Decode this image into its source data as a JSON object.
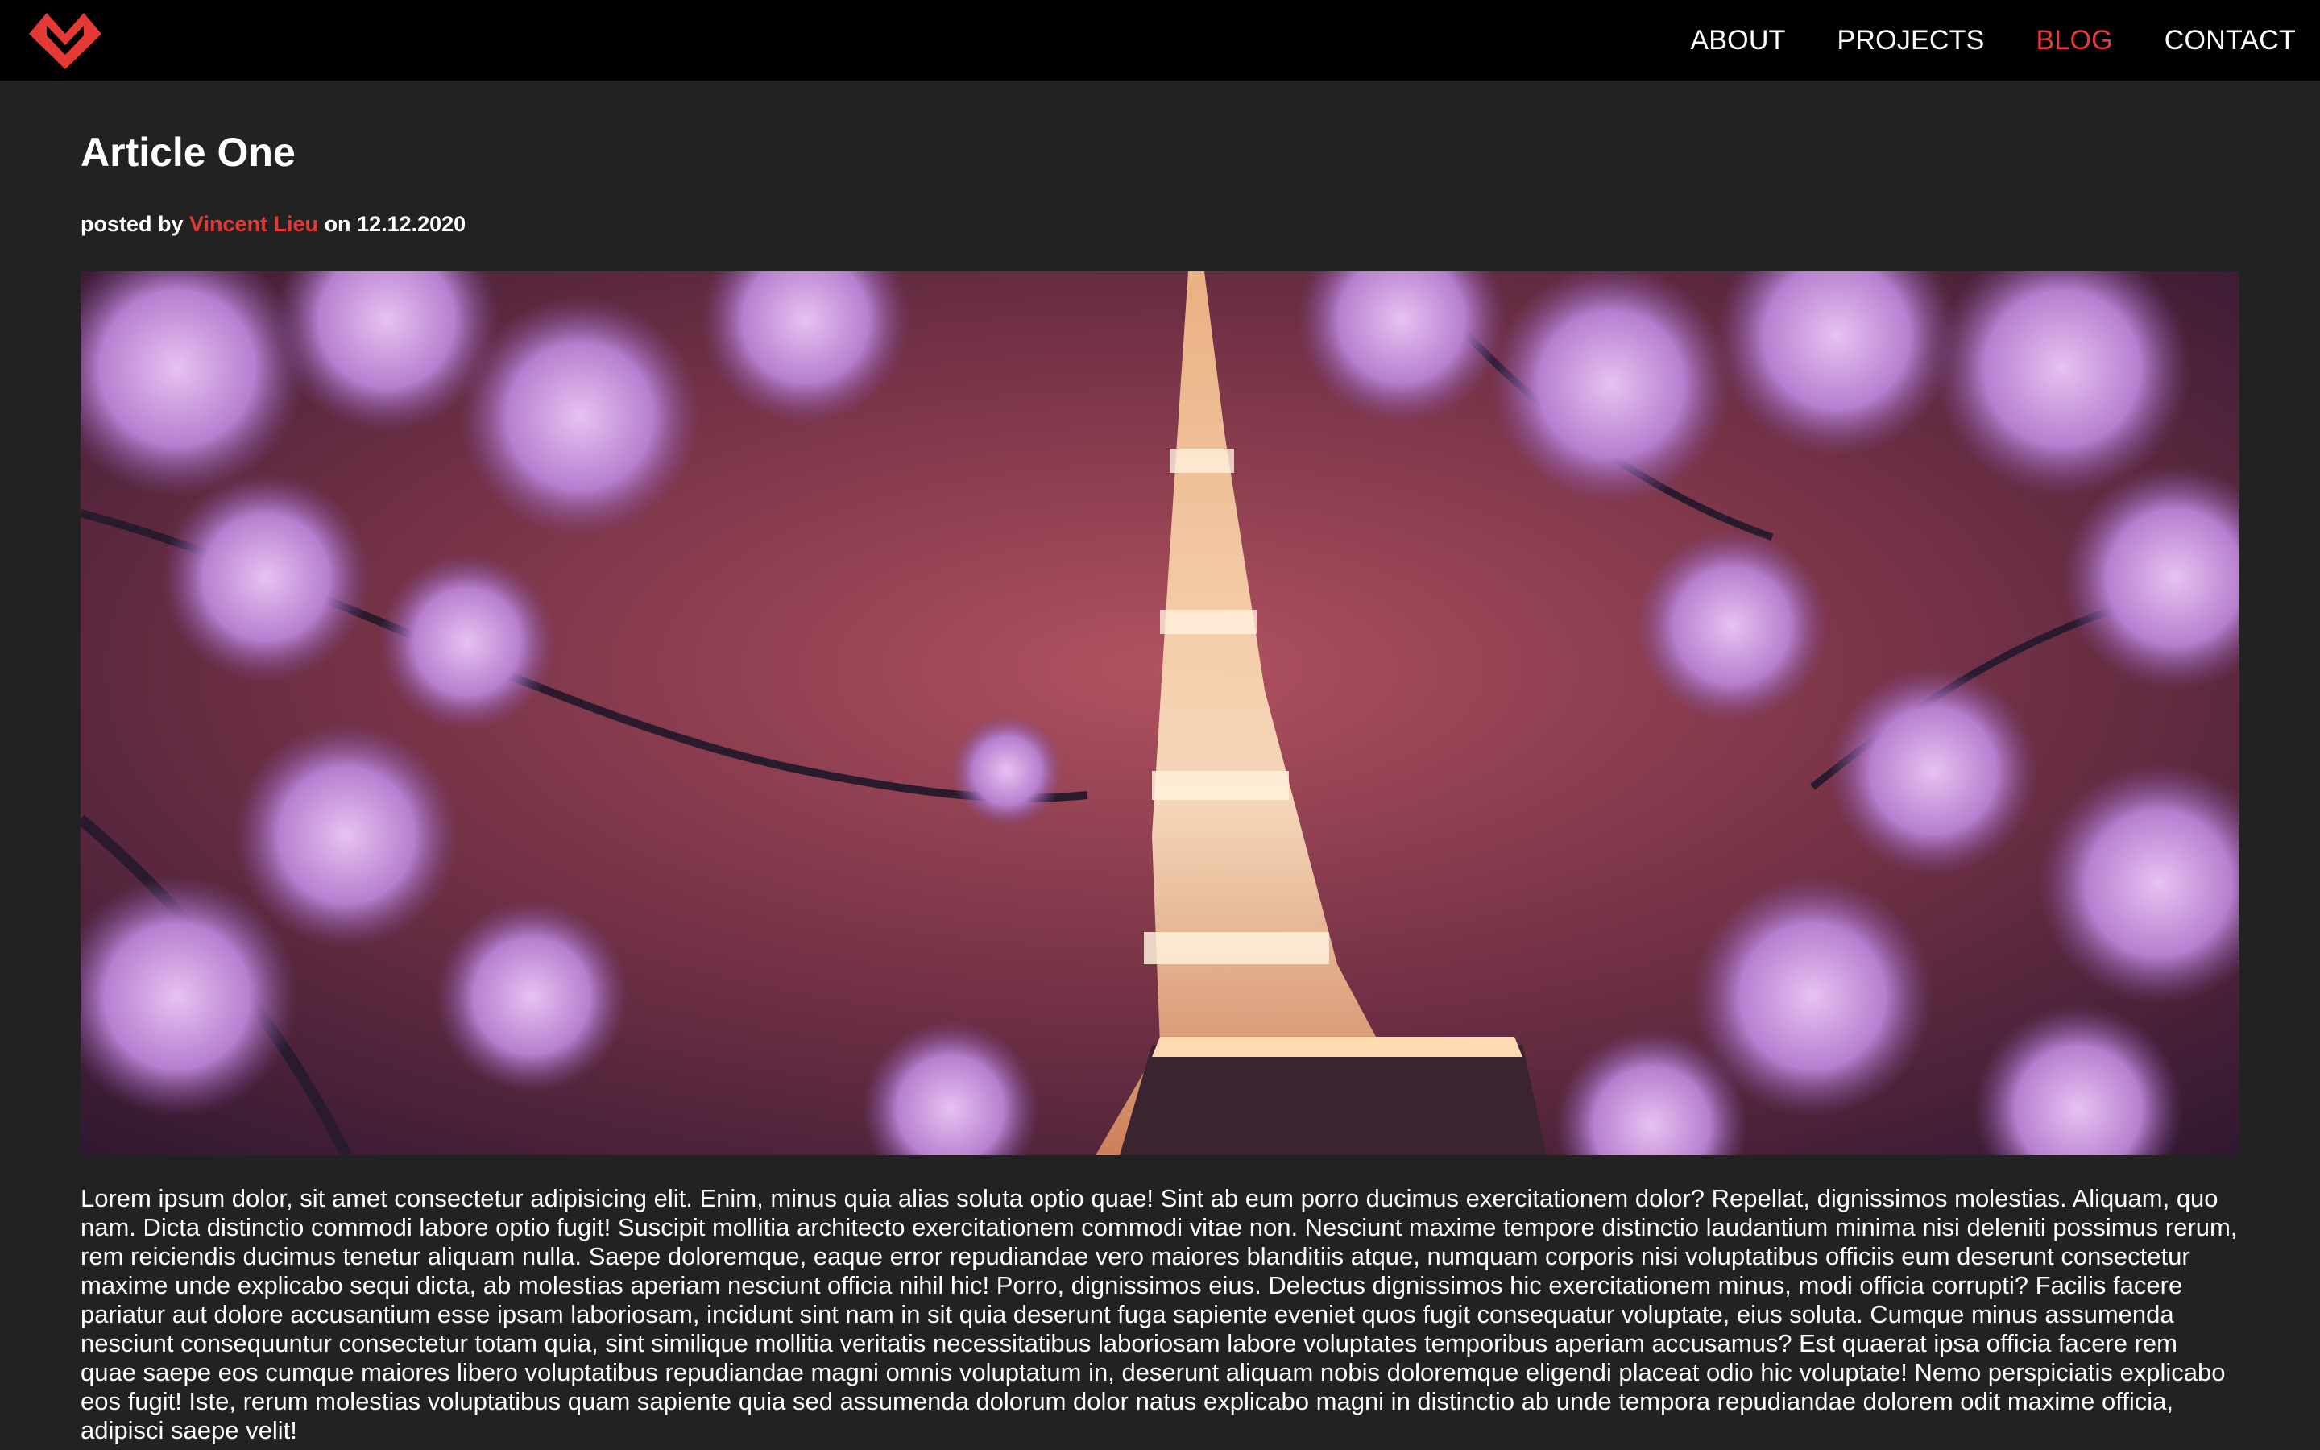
{
  "nav": {
    "links": [
      {
        "label": "ABOUT",
        "active": false
      },
      {
        "label": "PROJECTS",
        "active": false
      },
      {
        "label": "BLOG",
        "active": true
      },
      {
        "label": "CONTACT",
        "active": false
      }
    ],
    "logo_icon": "chevron-heart-logo",
    "accent_color": "#e53935"
  },
  "article": {
    "title": "Article One",
    "byline_prefix": "posted by ",
    "author": "Vincent Lieu",
    "byline_mid": " on ",
    "date": "12.12.2020",
    "hero_image": "tower-cherry-blossoms-photo",
    "body": "Lorem ipsum dolor, sit amet consectetur adipisicing elit. Enim, minus quia alias soluta optio quae! Sint ab eum porro ducimus exercitationem dolor? Repellat, dignissimos molestias. Aliquam, quo nam. Dicta distinctio commodi labore optio fugit! Suscipit mollitia architecto exercitationem commodi vitae non. Nesciunt maxime tempore distinctio laudantium minima nisi deleniti possimus rerum, rem reiciendis ducimus tenetur aliquam nulla. Saepe doloremque, eaque error repudiandae vero maiores blanditiis atque, numquam corporis nisi voluptatibus officiis eum deserunt consectetur maxime unde explicabo sequi dicta, ab molestias aperiam nesciunt officia nihil hic! Porro, dignissimos eius. Delectus dignissimos hic exercitationem minus, modi officia corrupti? Facilis facere pariatur aut dolore accusantium esse ipsam laboriosam, incidunt sint nam in sit quia deserunt fuga sapiente eveniet quos fugit consequatur voluptate, eius soluta. Cumque minus assumenda nesciunt consequuntur consectetur totam quia, sint similique mollitia veritatis necessitatibus laboriosam labore voluptates temporibus aperiam accusamus? Est quaerat ipsa officia facere rem quae saepe eos cumque maiores libero voluptatibus repudiandae magni omnis voluptatum in, deserunt aliquam nobis doloremque eligendi placeat odio hic voluptate! Nemo perspiciatis explicabo eos fugit! Iste, rerum molestias voluptatibus quam sapiente quia sed assumenda dolorum dolor natus explicabo magni in distinctio ab unde tempora repudiandae dolorem odit maxime officia, adipisci saepe velit!"
  }
}
